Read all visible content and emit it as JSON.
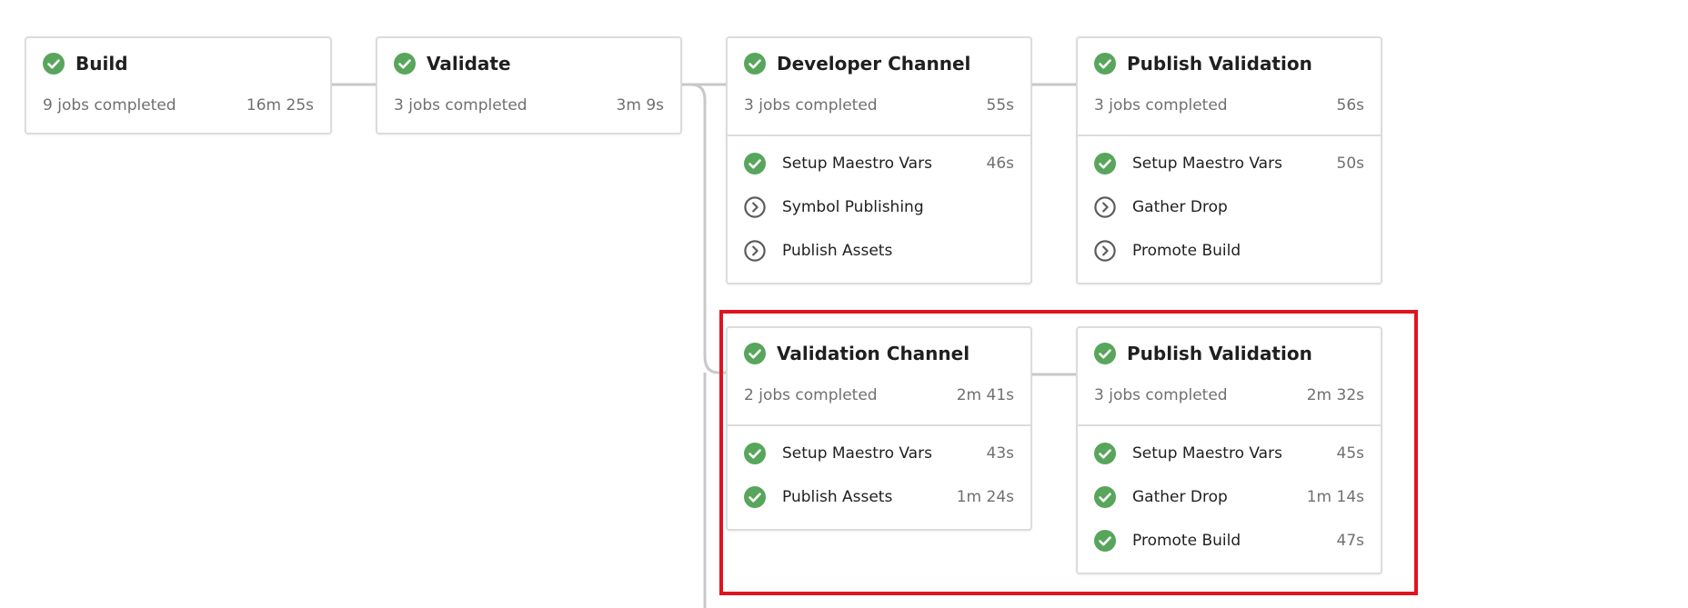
{
  "colors": {
    "success": "#58a55c",
    "pending": "#5c5c5c",
    "connector": "#c8c8c8",
    "highlight": "#e0141e"
  },
  "stages": [
    {
      "title": "Build",
      "summary": "9 jobs completed",
      "duration": "16m 25s",
      "status": "success",
      "jobs": []
    },
    {
      "title": "Validate",
      "summary": "3 jobs completed",
      "duration": "3m 9s",
      "status": "success",
      "jobs": []
    },
    {
      "title": "Developer Channel",
      "summary": "3 jobs completed",
      "duration": "55s",
      "status": "success",
      "jobs": [
        {
          "name": "Setup Maestro Vars",
          "duration": "46s",
          "status": "success"
        },
        {
          "name": "Symbol Publishing",
          "duration": "",
          "status": "pending"
        },
        {
          "name": "Publish Assets",
          "duration": "",
          "status": "pending"
        }
      ]
    },
    {
      "title": "Publish Validation",
      "summary": "3 jobs completed",
      "duration": "56s",
      "status": "success",
      "jobs": [
        {
          "name": "Setup Maestro Vars",
          "duration": "50s",
          "status": "success"
        },
        {
          "name": "Gather Drop",
          "duration": "",
          "status": "pending"
        },
        {
          "name": "Promote Build",
          "duration": "",
          "status": "pending"
        }
      ]
    },
    {
      "title": "Validation Channel",
      "summary": "2 jobs completed",
      "duration": "2m 41s",
      "status": "success",
      "jobs": [
        {
          "name": "Setup Maestro Vars",
          "duration": "43s",
          "status": "success"
        },
        {
          "name": "Publish Assets",
          "duration": "1m 24s",
          "status": "success"
        }
      ]
    },
    {
      "title": "Publish Validation",
      "summary": "3 jobs completed",
      "duration": "2m 32s",
      "status": "success",
      "jobs": [
        {
          "name": "Setup Maestro Vars",
          "duration": "45s",
          "status": "success"
        },
        {
          "name": "Gather Drop",
          "duration": "1m 14s",
          "status": "success"
        },
        {
          "name": "Promote Build",
          "duration": "47s",
          "status": "success"
        }
      ]
    }
  ]
}
